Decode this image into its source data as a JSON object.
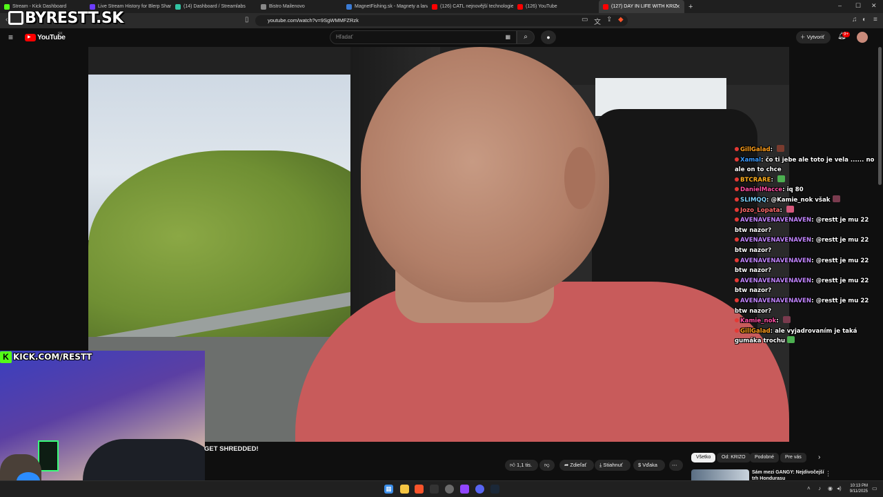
{
  "browser": {
    "tabs": [
      {
        "label": "Stream - Kick Dashboard",
        "color": "#53fc18"
      },
      {
        "label": "Live Stream History for Blerp Shares",
        "color": "#6c3cff"
      },
      {
        "label": "(14) Dashboard / Streamlabs",
        "color": "#31c3a2"
      },
      {
        "label": "Bistro Mailenovo",
        "color": "#888888"
      },
      {
        "label": "MagnetFishing.sk - Magnety a laná p",
        "color": "#3a7bd5"
      },
      {
        "label": "(126) CATL nejnovější technologie h",
        "color": "#ff0000"
      },
      {
        "label": "(126) YouTube",
        "color": "#ff0000"
      },
      {
        "label": "(127) DAY IN LIFE WITH KRIZ",
        "color": "#ff0000"
      }
    ],
    "active_tab_index": 7,
    "url": "youtube.com/watch?v=9SgWMMFZRzk",
    "window_controls": [
      "–",
      "☐",
      "✕"
    ]
  },
  "watermark": {
    "text": "BYRESTT.SK"
  },
  "youtube": {
    "logo_text": "YouTube",
    "region": "SK",
    "search_placeholder": "Hľadať",
    "create_label": "Vytvoriť",
    "notifications_badge": "9+"
  },
  "chat": [
    {
      "user": "GillGalad",
      "text": "",
      "user_color": "#ff9f1c",
      "emote_color": "#7a3b2e"
    },
    {
      "user": "Xamal",
      "text": "čo ti jebe ale toto je vela ...... no ale on to chce",
      "user_color": "#3b9bff",
      "emote_color": ""
    },
    {
      "user": "BTCRARE",
      "text": "",
      "user_color": "#ffb020",
      "emote_color": "#4caf50"
    },
    {
      "user": "DanielMacce",
      "text": "iq 80",
      "user_color": "#ff4fa3",
      "emote_color": ""
    },
    {
      "user": "SLIMQQ",
      "text": "@Kamie_nok však",
      "user_color": "#7dd3fc",
      "emote_color": "#7a3b4e"
    },
    {
      "user": "Jozo_Lopata",
      "text": "",
      "user_color": "#ff6b6b",
      "emote_color": "#d4577a"
    },
    {
      "user": "AVENAVENAVENAVEN",
      "text": "@restt je mu 22 btw nazor?",
      "user_color": "#c084fc",
      "emote_color": ""
    },
    {
      "user": "AVENAVENAVENAVEN",
      "text": "@restt je mu 22 btw nazor?",
      "user_color": "#c084fc",
      "emote_color": ""
    },
    {
      "user": "AVENAVENAVENAVEN",
      "text": "@restt je mu 22 btw nazor?",
      "user_color": "#c084fc",
      "emote_color": ""
    },
    {
      "user": "AVENAVENAVENAVEN",
      "text": "@restt je mu 22 btw nazor?",
      "user_color": "#c084fc",
      "emote_color": ""
    },
    {
      "user": "AVENAVENAVENAVEN",
      "text": "@restt je mu 22 btw nazor?",
      "user_color": "#c084fc",
      "emote_color": ""
    },
    {
      "user": "Kamie_nok",
      "text": "",
      "user_color": "#ff4fa3",
      "emote_color": "#7a3b4e"
    },
    {
      "user": "GillGalad",
      "text": "ale vyjadrovaním je taká gumáka trochu",
      "user_color": "#ff9f1c",
      "emote_color": "#4caf50"
    }
  ],
  "webcam": {
    "label": "KICK.COM/RESTT",
    "badge": "K"
  },
  "video": {
    "title_fragment": "GET SHREDDED!"
  },
  "actions": {
    "like_count": "1,1 tis.",
    "share_label": "Zdieľať",
    "download_label": "Stiahnuť",
    "thanks_label": "Vďaka",
    "more": "⋯"
  },
  "chips": [
    {
      "label": "Všetko",
      "selected": true
    },
    {
      "label": "Od: KRIZO",
      "selected": false
    },
    {
      "label": "Podobné",
      "selected": false
    },
    {
      "label": "Pre vás",
      "selected": false
    }
  ],
  "recommendation": {
    "title": "Sám mezi GANGY: Nejdivočejší trh Hondurasu"
  },
  "taskbar": {
    "time": "10:13 PM",
    "date": "9/11/2025"
  }
}
